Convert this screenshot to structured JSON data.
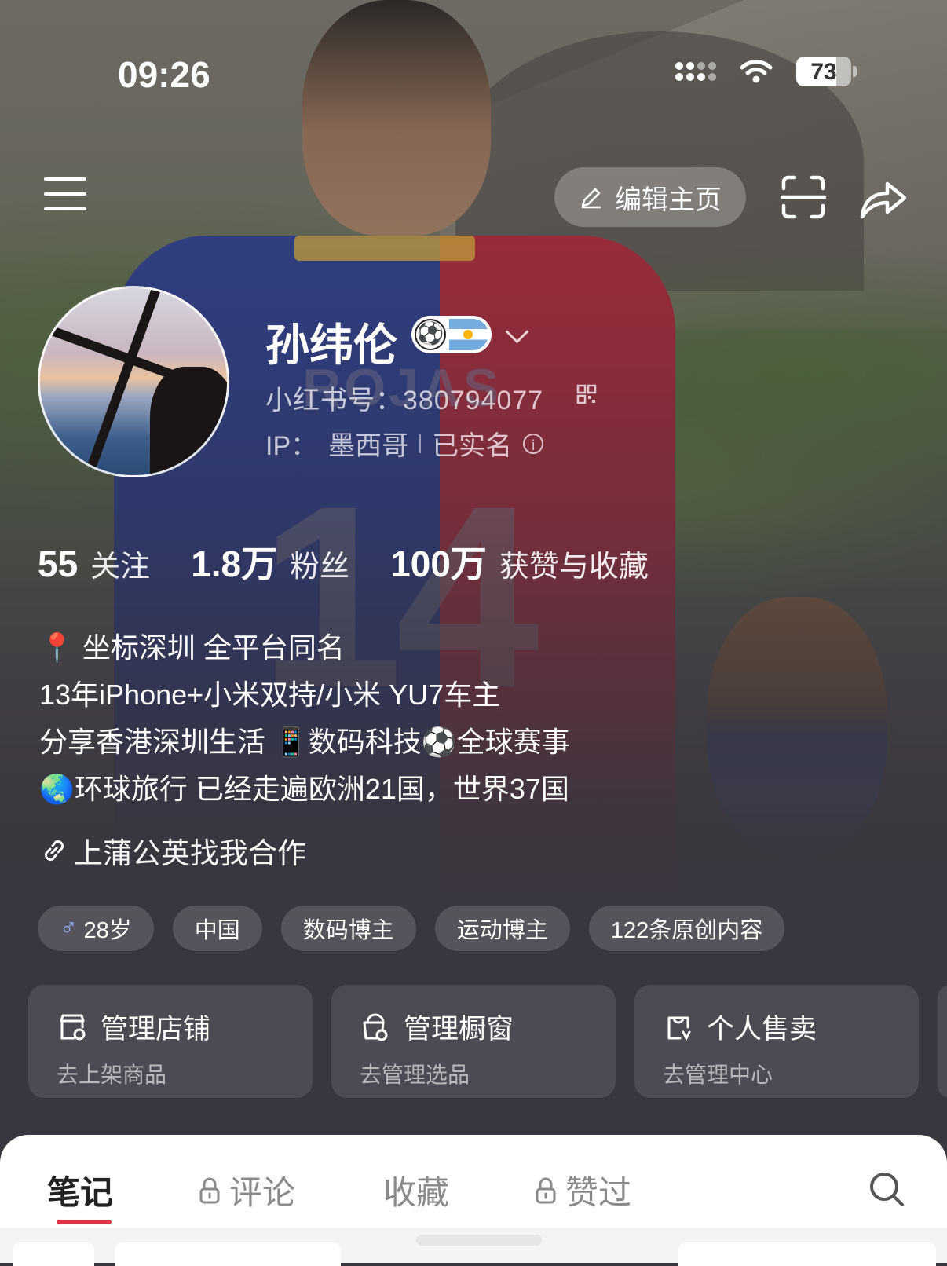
{
  "status_bar": {
    "time": "09:26",
    "battery": 73
  },
  "header": {
    "edit_label": "编辑主页"
  },
  "profile": {
    "name": "孙纬伦",
    "id_line": "小红书号：380794077",
    "ip_label": "IP：",
    "ip_location": "墨西哥",
    "verified": "已实名"
  },
  "stats": [
    {
      "num": "55",
      "label": "关注"
    },
    {
      "num": "1.8万",
      "label": "粉丝"
    },
    {
      "num": "100万",
      "label": "获赞与收藏"
    }
  ],
  "bio": [
    "📍 坐标深圳 全平台同名",
    "13年iPhone+小米双持/小米  YU7车主",
    "分享香港深圳生活 📱数码科技⚽全球赛事",
    "🌏环球旅行 已经走遍欧洲21国，世界37国"
  ],
  "link_text": "上蒲公英找我合作",
  "tags": [
    {
      "symbol": "♂",
      "label": "28岁"
    },
    {
      "label": "中国"
    },
    {
      "label": "数码博主"
    },
    {
      "label": "运动博主"
    },
    {
      "label": "122条原创内容"
    }
  ],
  "cards": [
    {
      "title": "管理店铺",
      "sub": "去上架商品",
      "icon": "store-icon"
    },
    {
      "title": "管理橱窗",
      "sub": "去管理选品",
      "icon": "showcase-icon"
    },
    {
      "title": "个人售卖",
      "sub": "去管理中心",
      "icon": "sell-icon"
    }
  ],
  "tabs": [
    {
      "label": "笔记",
      "locked": false,
      "active": true
    },
    {
      "label": "评论",
      "locked": true
    },
    {
      "label": "收藏",
      "locked": false
    },
    {
      "label": "赞过",
      "locked": true
    }
  ],
  "colors": {
    "accent": "#e0344c",
    "background": "#3a3640"
  }
}
